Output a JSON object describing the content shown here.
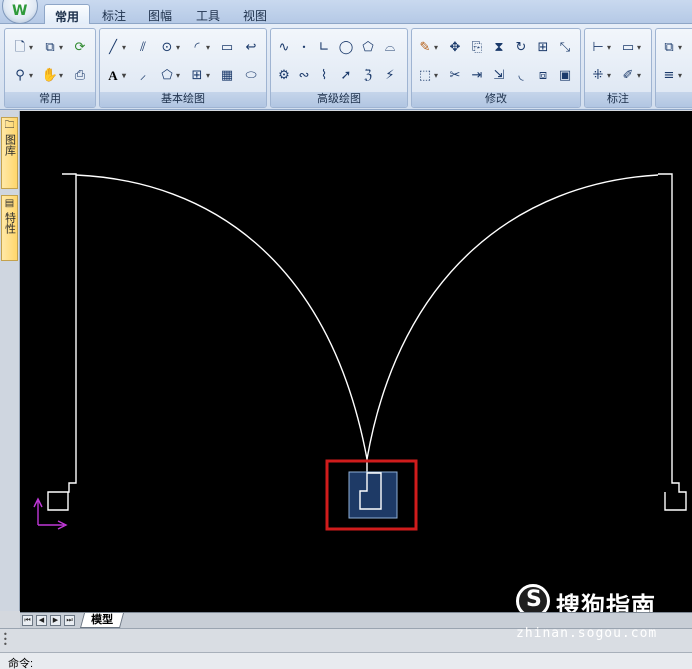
{
  "ribbon": {
    "tabs": [
      {
        "label": "常用",
        "active": true
      },
      {
        "label": "标注",
        "active": false
      },
      {
        "label": "图幅",
        "active": false
      },
      {
        "label": "工具",
        "active": false
      },
      {
        "label": "视图",
        "active": false
      }
    ],
    "groups": [
      {
        "label": "常用"
      },
      {
        "label": "基本绘图"
      },
      {
        "label": "高级绘图"
      },
      {
        "label": "修改"
      },
      {
        "label": "标注"
      }
    ],
    "text_tool_glyph": "A"
  },
  "palette": {
    "tabs": [
      {
        "label": "图库"
      },
      {
        "label": "特性"
      }
    ]
  },
  "layout": {
    "active_tab": "模型"
  },
  "command": {
    "prompt": "命令:"
  },
  "watermark": {
    "logo_glyph": "S",
    "name": "搜狗指南",
    "url": "zhinan.sogou.com"
  },
  "colors": {
    "canvas_background": "#000000",
    "geometry": "#ffffff",
    "highlight_box": "#d01c1c",
    "selected_block_fill": "#1e3a66",
    "ucs_icon": "#c038d8"
  }
}
